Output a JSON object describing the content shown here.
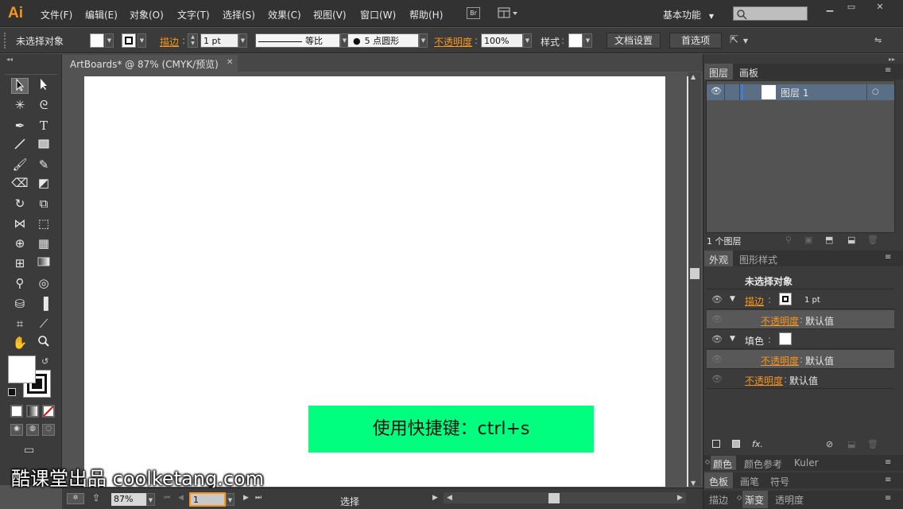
{
  "app": {
    "logo": "Ai",
    "menu": [
      "文件(F)",
      "编辑(E)",
      "对象(O)",
      "文字(T)",
      "选择(S)",
      "效果(C)",
      "视图(V)",
      "窗口(W)",
      "帮助(H)"
    ],
    "bridge_label": "Br",
    "workspace": "基本功能",
    "search_placeholder": ""
  },
  "control": {
    "selection": "未选择对象",
    "stroke_label": "描边",
    "stroke_value": "1 pt",
    "profile_label": "等比",
    "brush_label": "5 点圆形",
    "opacity_label": "不透明度",
    "opacity_value": "100%",
    "style_label": "样式",
    "doc_settings": "文档设置",
    "preferences": "首选项"
  },
  "document": {
    "tab_title": "ArtBoards* @ 87% (CMYK/预览)"
  },
  "status": {
    "zoom": "87%",
    "page": "1",
    "tool": "选择"
  },
  "overlay": {
    "banner_text": "使用快捷键：ctrl+s",
    "watermark": "酷课堂出品 coolketang.com"
  },
  "layers_panel": {
    "tabs": [
      "图层",
      "画板"
    ],
    "layer_name": "图层 1",
    "footer": "1 个图层"
  },
  "appearance_panel": {
    "tabs": [
      "外观",
      "图形样式"
    ],
    "title": "未选择对象",
    "stroke_label": "描边",
    "stroke_value": "1 pt",
    "opacity_label": "不透明度",
    "opacity_value": "默认值",
    "fill_label": "填色",
    "fx_label": "fx."
  },
  "bottom_panels": {
    "group1": [
      "颜色",
      "颜色参考",
      "Kuler"
    ],
    "group2": [
      "色板",
      "画笔",
      "符号"
    ],
    "group3": [
      "描边",
      "渐变",
      "透明度"
    ]
  },
  "colors": {
    "accent_orange": "#f7941d",
    "banner_green": "#00ff7f",
    "layer_blue": "#3d7fd6"
  }
}
